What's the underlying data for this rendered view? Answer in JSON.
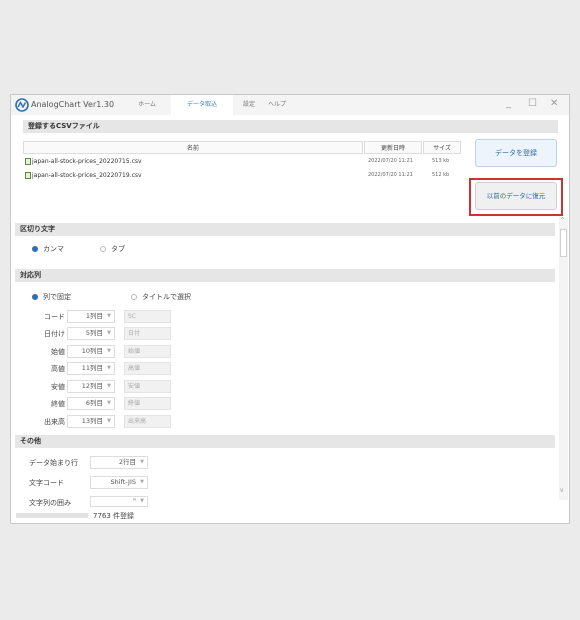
{
  "app": {
    "title": "AnalogChart Ver1.30"
  },
  "menu": {
    "home": "ホーム",
    "import": "データ取込",
    "settings": "設定",
    "help": "ヘルプ"
  },
  "window_buttons": {
    "minimize": "_",
    "maximize": "☐",
    "close": "✕"
  },
  "csv_section": {
    "title": "登録するCSVファイル",
    "columns": [
      "名前",
      "更新日時",
      "サイズ"
    ],
    "files": [
      {
        "name": "japan-all-stock-prices_20220715.csv",
        "updated": "2022/07/20 11:21",
        "size": "513 kb"
      },
      {
        "name": "japan-all-stock-prices_20220719.csv",
        "updated": "2022/07/20 11:21",
        "size": "512 kb"
      }
    ],
    "register_button": "データを登録",
    "restore_button": "以前のデータに復元"
  },
  "delimiter": {
    "title": "区切り文字",
    "options": [
      "カンマ",
      "タブ"
    ],
    "selected": "カンマ"
  },
  "columns_section": {
    "title": "対応列",
    "options": [
      "列で固定",
      "タイトルで選択"
    ],
    "selected": "列で固定",
    "rows": [
      {
        "label": "コード",
        "column": "1列目",
        "field": "SC"
      },
      {
        "label": "日付け",
        "column": "5列目",
        "field": "日付"
      },
      {
        "label": "始値",
        "column": "10列目",
        "field": "始値"
      },
      {
        "label": "高値",
        "column": "11列目",
        "field": "高値"
      },
      {
        "label": "安値",
        "column": "12列目",
        "field": "安値"
      },
      {
        "label": "終値",
        "column": "6列目",
        "field": "終値"
      },
      {
        "label": "出来高",
        "column": "13列目",
        "field": "出来高"
      }
    ]
  },
  "other": {
    "title": "その他",
    "data_start_label": "データ始まり行",
    "data_start_value": "2行目",
    "encoding_label": "文字コード",
    "encoding_value": "Shift-JIS",
    "quote_label": "文字列の囲み",
    "quote_value": "\""
  },
  "status": {
    "text": "7763 件登録",
    "progress": 0
  },
  "colors": {
    "accent": "#2d6fb8",
    "highlight_border": "#cc3333",
    "band": "#e6e6e6"
  }
}
